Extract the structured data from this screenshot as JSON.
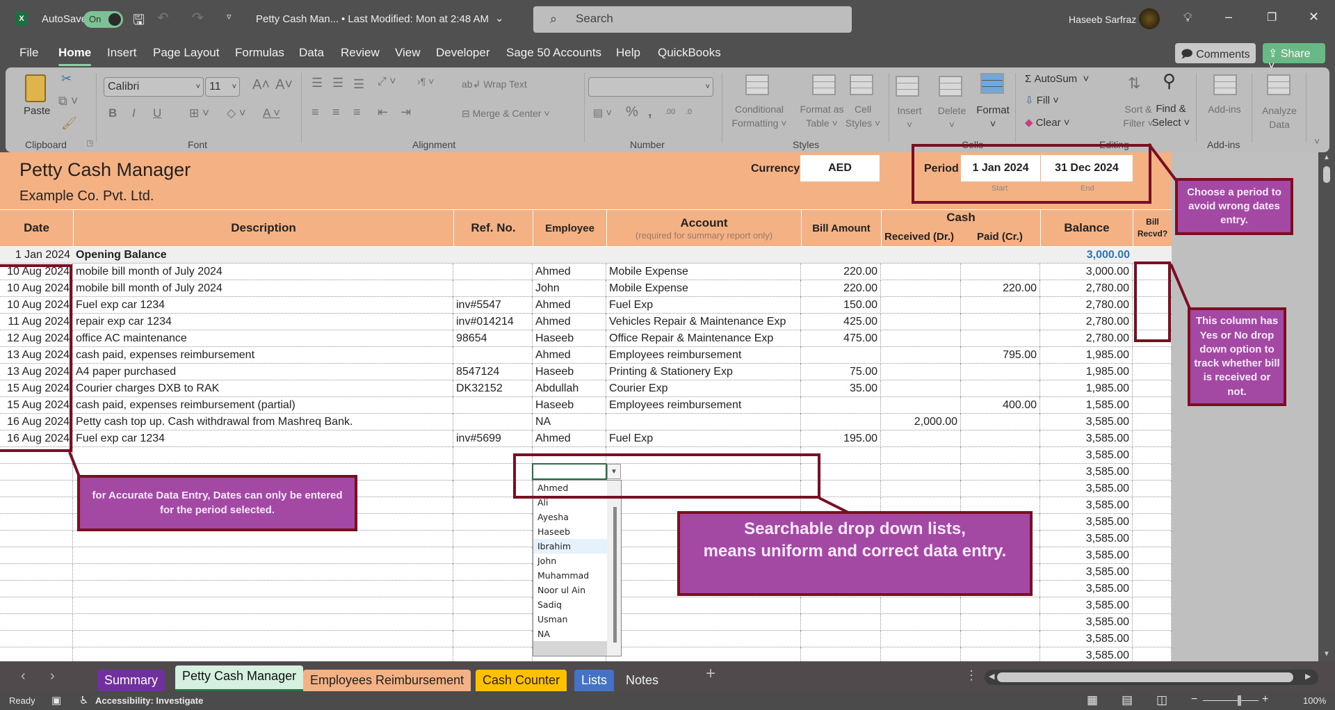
{
  "titlebar": {
    "app_icon": "excel-icon",
    "autosave_label": "AutoSave",
    "autosave_state": "On",
    "doc_title": "Petty Cash Man...",
    "modified": "• Last Modified: Mon at 2:48 AM",
    "search_placeholder": "Search",
    "user_name": "Haseeb Sarfraz"
  },
  "menu": {
    "items": [
      "File",
      "Home",
      "Insert",
      "Page Layout",
      "Formulas",
      "Data",
      "Review",
      "View",
      "Developer",
      "Sage 50 Accounts",
      "Help",
      "QuickBooks"
    ],
    "active": "Home",
    "comments_label": "Comments",
    "share_label": "Share"
  },
  "ribbon": {
    "clipboard": {
      "paste": "Paste",
      "label": "Clipboard"
    },
    "font": {
      "name": "Calibri",
      "size": "11",
      "label": "Font"
    },
    "alignment": {
      "wrap": "Wrap Text",
      "merge": "Merge & Center",
      "label": "Alignment"
    },
    "number": {
      "format": "",
      "label": "Number"
    },
    "styles": {
      "cond1": "Conditional",
      "cond2": "Formatting",
      "fmt1": "Format as",
      "fmt2": "Table",
      "cell1": "Cell",
      "cell2": "Styles",
      "label": "Styles"
    },
    "cells": {
      "insert": "Insert",
      "delete": "Delete",
      "format": "Format",
      "label": "Cells"
    },
    "editing": {
      "autosum": "AutoSum",
      "fill": "Fill",
      "clear": "Clear",
      "sort1": "Sort &",
      "sort2": "Filter",
      "find1": "Find &",
      "find2": "Select",
      "label": "Editing"
    },
    "addins": {
      "addins1": "Add-ins",
      "label": "Add-ins",
      "analyze1": "Analyze",
      "analyze2": "Data"
    }
  },
  "sheet": {
    "title": "Petty Cash Manager",
    "company": "Example Co. Pvt. Ltd.",
    "currency_label": "Currency",
    "currency": "AED",
    "period_label": "Period",
    "period_start": "1 Jan 2024",
    "period_end": "31 Dec 2024",
    "start_label": "Start",
    "end_label": "End",
    "headers": {
      "date": "Date",
      "description": "Description",
      "ref": "Ref. No.",
      "employee": "Employee",
      "account": "Account",
      "account_note": "(required for summary report only)",
      "bill_amount": "Bill Amount",
      "cash": "Cash",
      "received": "Received (Dr.)",
      "paid": "Paid (Cr.)",
      "balance": "Balance",
      "bill_recvd": "Bill Recvd?"
    },
    "opening": {
      "date": "1 Jan 2024",
      "description": "Opening Balance",
      "balance": "3,000.00"
    },
    "rows": [
      {
        "date": "10 Aug 2024",
        "description": "mobile bill month of July 2024",
        "ref": "",
        "employee": "Ahmed",
        "account": "Mobile Expense",
        "bill": "220.00",
        "received": "",
        "paid": "",
        "balance": "3,000.00"
      },
      {
        "date": "10 Aug 2024",
        "description": "mobile bill month of July 2024",
        "ref": "",
        "employee": "John",
        "account": "Mobile Expense",
        "bill": "220.00",
        "received": "",
        "paid": "220.00",
        "balance": "2,780.00"
      },
      {
        "date": "10 Aug 2024",
        "description": "Fuel exp car 1234",
        "ref": "inv#5547",
        "employee": "Ahmed",
        "account": "Fuel Exp",
        "bill": "150.00",
        "received": "",
        "paid": "",
        "balance": "2,780.00"
      },
      {
        "date": "11 Aug 2024",
        "description": "repair exp car   1234",
        "ref": "inv#014214",
        "employee": "Ahmed",
        "account": "Vehicles Repair & Maintenance Exp",
        "bill": "425.00",
        "received": "",
        "paid": "",
        "balance": "2,780.00"
      },
      {
        "date": "12 Aug 2024",
        "description": "office AC maintenance",
        "ref": "98654",
        "employee": "Haseeb",
        "account": "Office Repair & Maintenance Exp",
        "bill": "475.00",
        "received": "",
        "paid": "",
        "balance": "2,780.00"
      },
      {
        "date": "13 Aug 2024",
        "description": "cash paid, expenses reimbursement",
        "ref": "",
        "employee": "Ahmed",
        "account": "Employees reimbursement",
        "bill": "",
        "received": "",
        "paid": "795.00",
        "balance": "1,985.00"
      },
      {
        "date": "13 Aug 2024",
        "description": "A4 paper purchased",
        "ref": "8547124",
        "employee": "Haseeb",
        "account": "Printing & Stationery Exp",
        "bill": "75.00",
        "received": "",
        "paid": "",
        "balance": "1,985.00"
      },
      {
        "date": "15 Aug 2024",
        "description": "Courier charges DXB to RAK",
        "ref": "DK32152",
        "employee": "Abdullah",
        "account": "Courier Exp",
        "bill": "35.00",
        "received": "",
        "paid": "",
        "balance": "1,985.00"
      },
      {
        "date": "15 Aug 2024",
        "description": "cash paid, expenses reimbursement (partial)",
        "ref": "",
        "employee": "Haseeb",
        "account": "Employees reimbursement",
        "bill": "",
        "received": "",
        "paid": "400.00",
        "balance": "1,585.00"
      },
      {
        "date": "16 Aug 2024",
        "description": "Petty cash top up. Cash withdrawal from Mashreq Bank.",
        "ref": "",
        "employee": "NA",
        "account": "",
        "bill": "",
        "received": "2,000.00",
        "paid": "",
        "balance": "3,585.00"
      },
      {
        "date": "16 Aug 2024",
        "description": "Fuel exp car 1234",
        "ref": "inv#5699",
        "employee": "Ahmed",
        "account": "Fuel Exp",
        "bill": "195.00",
        "received": "",
        "paid": "",
        "balance": "3,585.00"
      }
    ],
    "empty_balance": "3,585.00",
    "empty_rows": 13
  },
  "dropdown": {
    "options": [
      "Ahmed",
      "Ali",
      "Ayesha",
      "Haseeb",
      "Ibrahim",
      "John",
      "Muhammad",
      "Noor ul Ain",
      "Sadiq",
      "Usman",
      "NA"
    ],
    "highlighted": "Ibrahim"
  },
  "annotations": {
    "period": "Choose a period to avoid wrong dates entry.",
    "bill_col": "This column has Yes or No drop down option to track whether bill is received or not.",
    "dates": "for Accurate Data Entry, Dates can only be entered for the period selected.",
    "dropdown_line1": "Searchable drop down lists,",
    "dropdown_line2": "means uniform and correct data entry."
  },
  "tabs": [
    {
      "label": "Summary",
      "color": "#7030a0",
      "text": "#ffffff"
    },
    {
      "label": "Petty Cash Manager",
      "color": "#d6f0e0",
      "text": "#111111",
      "active": true
    },
    {
      "label": "Employees Reimbursement",
      "color": "#f4b183",
      "text": "#222222"
    },
    {
      "label": "Cash  Counter",
      "color": "#ffc000",
      "text": "#222222"
    },
    {
      "label": "Lists",
      "color": "#4472c4",
      "text": "#ffffff"
    },
    {
      "label": "Notes",
      "color": "",
      "text": "#f0f0f0"
    }
  ],
  "status": {
    "ready": "Ready",
    "accessibility": "Accessibility: Investigate",
    "zoom": "100%"
  },
  "colors": {
    "header_fill": "#f4b183",
    "callout": "#a349a4",
    "callout_border": "#7a0f24",
    "balance_blue": "#2e75b6"
  }
}
